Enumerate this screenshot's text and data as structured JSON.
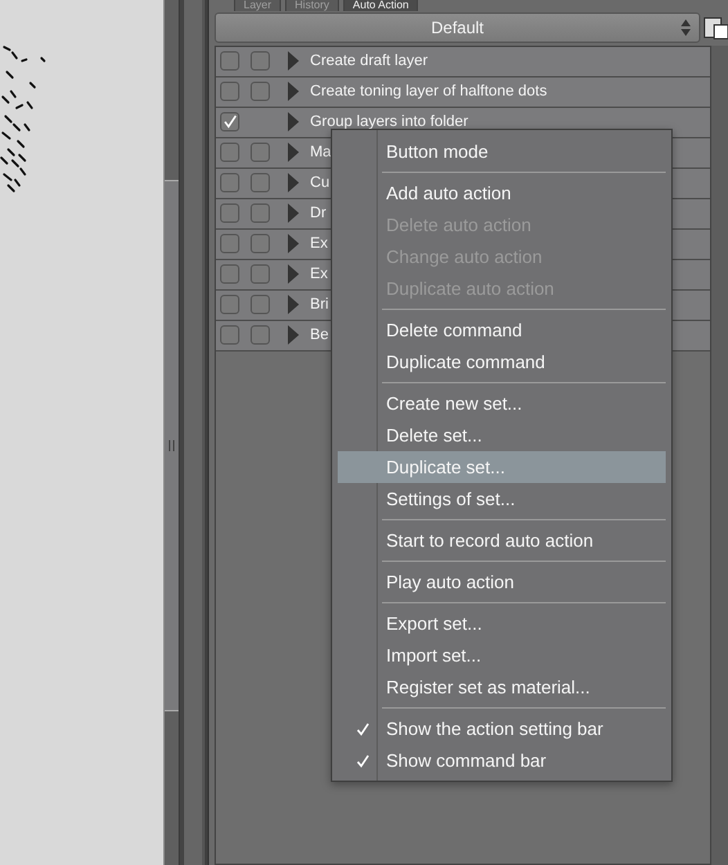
{
  "tabs": [
    {
      "label": "Layer",
      "selected": false
    },
    {
      "label": "History",
      "selected": false
    },
    {
      "label": "Auto Action",
      "selected": true
    }
  ],
  "set_dropdown": {
    "value": "Default"
  },
  "actions": [
    {
      "name": "Create draft layer",
      "checked": false,
      "dialog_box": true
    },
    {
      "name": "Create toning layer of halftone dots",
      "checked": false,
      "dialog_box": true
    },
    {
      "name": "Group layers into folder",
      "checked": true,
      "dialog_box": false
    },
    {
      "name": "Ma",
      "checked": false,
      "dialog_box": true
    },
    {
      "name": "Cu",
      "checked": false,
      "dialog_box": true
    },
    {
      "name": "Dr",
      "checked": false,
      "dialog_box": true
    },
    {
      "name": "Ex",
      "checked": false,
      "dialog_box": true
    },
    {
      "name": "Ex",
      "checked": false,
      "dialog_box": true
    },
    {
      "name": "Bri",
      "checked": false,
      "dialog_box": true
    },
    {
      "name": "Be",
      "checked": false,
      "dialog_box": true
    }
  ],
  "context_menu": {
    "groups": [
      [
        {
          "label": "Button mode",
          "disabled": false,
          "checked": false,
          "selected": false
        }
      ],
      [
        {
          "label": "Add auto action",
          "disabled": false,
          "checked": false,
          "selected": false
        },
        {
          "label": "Delete auto action",
          "disabled": true,
          "checked": false,
          "selected": false
        },
        {
          "label": "Change auto action",
          "disabled": true,
          "checked": false,
          "selected": false
        },
        {
          "label": "Duplicate auto action",
          "disabled": true,
          "checked": false,
          "selected": false
        }
      ],
      [
        {
          "label": "Delete command",
          "disabled": false,
          "checked": false,
          "selected": false
        },
        {
          "label": "Duplicate command",
          "disabled": false,
          "checked": false,
          "selected": false
        }
      ],
      [
        {
          "label": "Create new set...",
          "disabled": false,
          "checked": false,
          "selected": false
        },
        {
          "label": "Delete set...",
          "disabled": false,
          "checked": false,
          "selected": false
        },
        {
          "label": "Duplicate set...",
          "disabled": false,
          "checked": false,
          "selected": true
        },
        {
          "label": "Settings of set...",
          "disabled": false,
          "checked": false,
          "selected": false
        }
      ],
      [
        {
          "label": "Start to record auto action",
          "disabled": false,
          "checked": false,
          "selected": false
        }
      ],
      [
        {
          "label": "Play auto action",
          "disabled": false,
          "checked": false,
          "selected": false
        }
      ],
      [
        {
          "label": "Export set...",
          "disabled": false,
          "checked": false,
          "selected": false
        },
        {
          "label": "Import set...",
          "disabled": false,
          "checked": false,
          "selected": false
        },
        {
          "label": "Register set as material...",
          "disabled": false,
          "checked": false,
          "selected": false
        }
      ],
      [
        {
          "label": "Show the action setting bar",
          "disabled": false,
          "checked": true,
          "selected": false
        },
        {
          "label": "Show command bar",
          "disabled": false,
          "checked": true,
          "selected": false
        }
      ]
    ]
  }
}
